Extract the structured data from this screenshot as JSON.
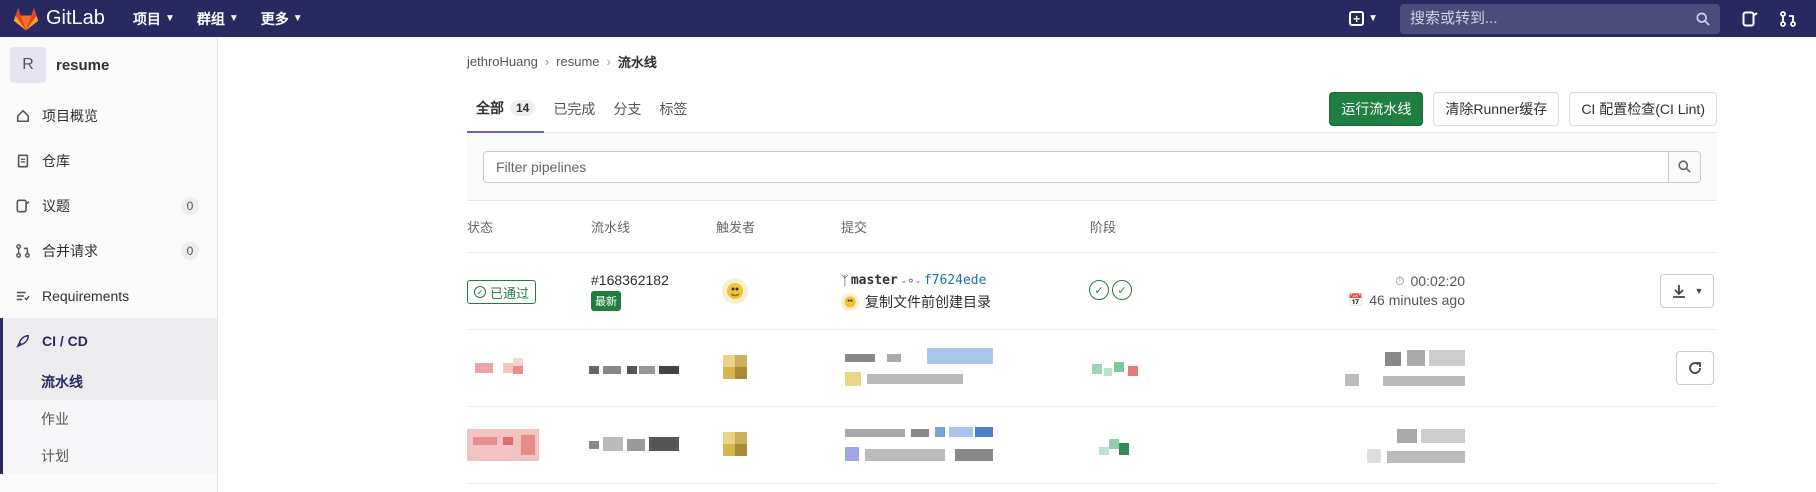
{
  "topbar": {
    "logo_text": "GitLab",
    "menu": [
      {
        "label": "项目"
      },
      {
        "label": "群组"
      },
      {
        "label": "更多"
      }
    ],
    "search_placeholder": "搜索或转到..."
  },
  "sidebar": {
    "project_avatar_letter": "R",
    "project_name": "resume",
    "items": [
      {
        "label": "项目概览",
        "icon": "home-icon"
      },
      {
        "label": "仓库",
        "icon": "document-icon"
      },
      {
        "label": "议题",
        "icon": "issues-icon",
        "count": "0"
      },
      {
        "label": "合并请求",
        "icon": "merge-request-icon",
        "count": "0"
      },
      {
        "label": "Requirements",
        "icon": "requirements-icon"
      },
      {
        "label": "CI / CD",
        "icon": "rocket-icon"
      }
    ],
    "sub_items": [
      {
        "label": "流水线"
      },
      {
        "label": "作业"
      },
      {
        "label": "计划"
      }
    ]
  },
  "breadcrumb": {
    "items": [
      "jethroHuang",
      "resume",
      "流水线"
    ]
  },
  "tabs": [
    {
      "label": "全部",
      "count": "14"
    },
    {
      "label": "已完成"
    },
    {
      "label": "分支"
    },
    {
      "label": "标签"
    }
  ],
  "actions": {
    "run_pipeline": "运行流水线",
    "clear_cache": "清除Runner缓存",
    "ci_lint": "CI 配置检查(CI Lint)"
  },
  "filter": {
    "placeholder": "Filter pipelines"
  },
  "table": {
    "headers": [
      "状态",
      "流水线",
      "触发者",
      "提交",
      "阶段"
    ],
    "rows": [
      {
        "status": "已通过",
        "pipeline_id": "#168362182",
        "latest_badge": "最新",
        "branch": "master",
        "sha": "f7624ede",
        "commit_message": "复制文件前创建目录",
        "duration": "00:02:20",
        "finished": "46 minutes ago"
      }
    ]
  },
  "colors": {
    "topbar": "#292961",
    "success": "#1f7f3f",
    "link": "#1f6db3"
  }
}
